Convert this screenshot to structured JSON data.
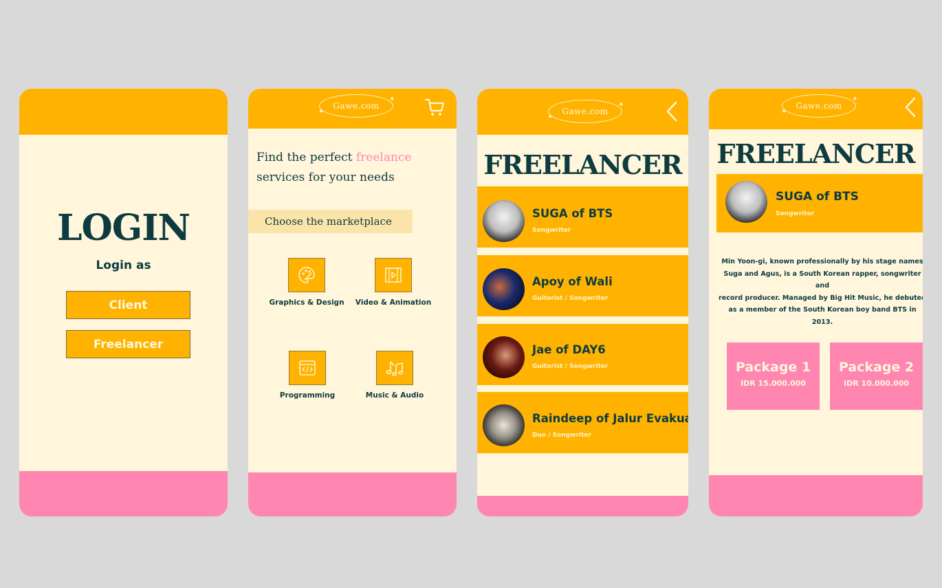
{
  "login_screen": {
    "title": "LOGIN",
    "subtitle": "Login as",
    "client_button": "Client",
    "freelancer_button": "Freelancer"
  },
  "marketplace_screen": {
    "logo": "Gawe.com",
    "headline_part1": "Find the perfect ",
    "headline_highlight": "freelance",
    "headline_part2": "services for your needs",
    "choose_label": "Choose the marketplace",
    "categories": [
      {
        "label": "Graphics & Design",
        "icon": "palette-icon"
      },
      {
        "label": "Video & Animation",
        "icon": "video-icon"
      },
      {
        "label": "Programming",
        "icon": "code-icon"
      },
      {
        "label": "Music & Audio",
        "icon": "music-icon"
      }
    ]
  },
  "freelancer_list_screen": {
    "logo": "Gawe.com",
    "title": "FREELANCER",
    "items": [
      {
        "name": "SUGA of BTS",
        "role": "Songwriter"
      },
      {
        "name": "Apoy of Wali",
        "role": "Guitarist / Songwriter"
      },
      {
        "name": "Jae of DAY6",
        "role": "Guitarist / Songwriter"
      },
      {
        "name": "Raindeep of Jalur Evakuasi",
        "role": "Duo / Songwriter"
      }
    ]
  },
  "freelancer_detail_screen": {
    "logo": "Gawe.com",
    "title": "FREELANCER",
    "name": "SUGA of BTS",
    "role": "Songwriter",
    "bio_lines": [
      "Min Yoon-gi, known professionally by his stage names",
      "Suga and Agus, is a South Korean rapper, songwriter and",
      "record producer. Managed by Big Hit Music, he debuted",
      "as a member of the South Korean boy band BTS in 2013."
    ],
    "packages": [
      {
        "name": "Package 1",
        "price": "IDR 15.000.000"
      },
      {
        "name": "Package 2",
        "price": "IDR 10.000.000"
      }
    ]
  },
  "colors": {
    "background": "#d9d9d9",
    "primary_yellow": "#ffb300",
    "cream": "#fff6dc",
    "pink": "#ff86b1",
    "dark_teal": "#0d3b3f"
  }
}
